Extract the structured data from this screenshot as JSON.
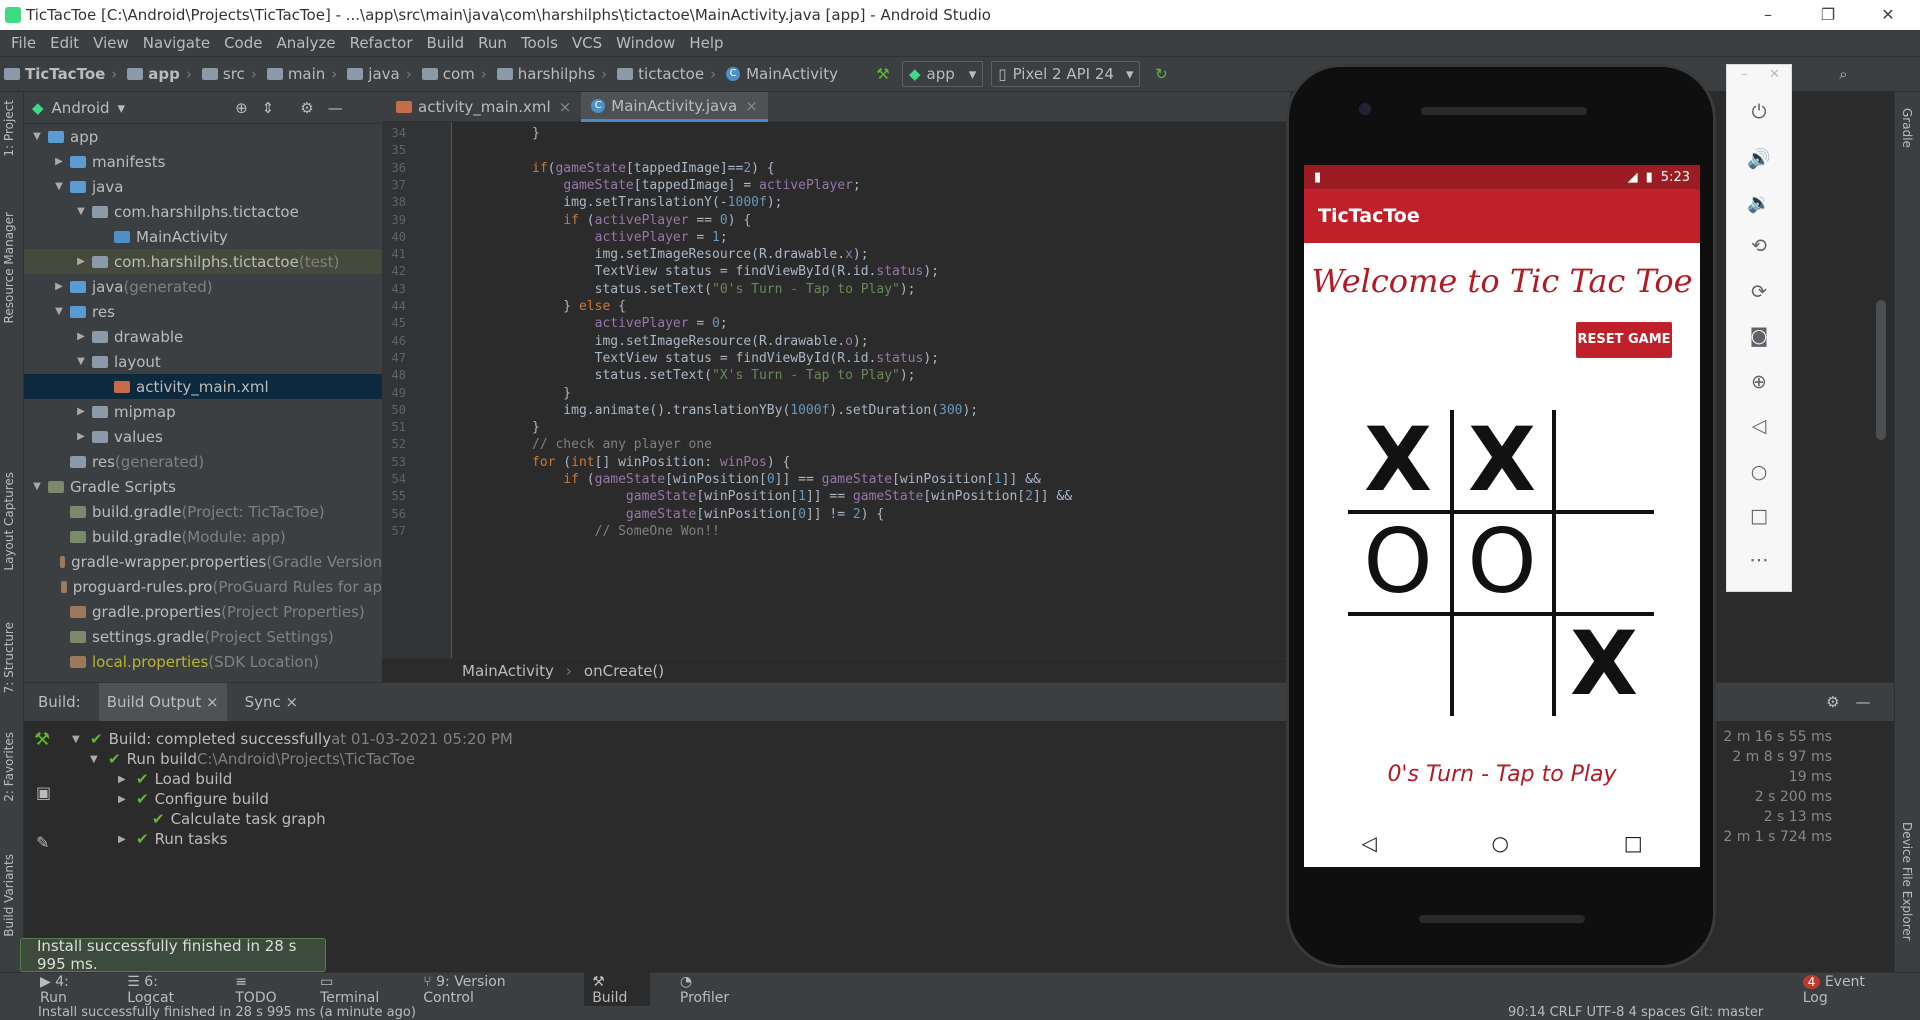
{
  "window": {
    "title": "TicTacToe [C:\\Android\\Projects\\TicTacToe] - ...\\app\\src\\main\\java\\com\\harshilphs\\tictactoe\\MainActivity.java [app] - Android Studio"
  },
  "menu": [
    "File",
    "Edit",
    "View",
    "Navigate",
    "Code",
    "Analyze",
    "Refactor",
    "Build",
    "Run",
    "Tools",
    "VCS",
    "Window",
    "Help"
  ],
  "breadcrumbs": [
    "TicTacToe",
    "app",
    "src",
    "main",
    "java",
    "com",
    "harshilphs",
    "tictactoe",
    "MainActivity"
  ],
  "toolbar": {
    "config": "app",
    "device": "Pixel 2 API 24"
  },
  "project": {
    "view": "Android",
    "tree": [
      {
        "label": "app",
        "extra": "",
        "depth": 0,
        "arrow": "▼",
        "color": "#5b9bd5"
      },
      {
        "label": "manifests",
        "extra": "",
        "depth": 1,
        "arrow": "▶",
        "color": "#5b9bd5"
      },
      {
        "label": "java",
        "extra": "",
        "depth": 1,
        "arrow": "▼",
        "color": "#5b9bd5"
      },
      {
        "label": "com.harshilphs.tictactoe",
        "extra": "",
        "depth": 2,
        "arrow": "▼",
        "color": "#8a9aa8"
      },
      {
        "label": "MainActivity",
        "extra": "",
        "depth": 3,
        "arrow": "",
        "color": "#4e8fc7"
      },
      {
        "label": "com.harshilphs.tictactoe",
        "extra": " (test)",
        "depth": 2,
        "arrow": "▶",
        "color": "#8a9aa8"
      },
      {
        "label": "java",
        "extra": " (generated)",
        "depth": 1,
        "arrow": "▶",
        "color": "#5b9bd5"
      },
      {
        "label": "res",
        "extra": "",
        "depth": 1,
        "arrow": "▼",
        "color": "#5b9bd5"
      },
      {
        "label": "drawable",
        "extra": "",
        "depth": 2,
        "arrow": "▶",
        "color": "#8a9aa8"
      },
      {
        "label": "layout",
        "extra": "",
        "depth": 2,
        "arrow": "▼",
        "color": "#8a9aa8"
      },
      {
        "label": "activity_main.xml",
        "extra": "",
        "depth": 3,
        "arrow": "",
        "color": "#c66b4b"
      },
      {
        "label": "mipmap",
        "extra": "",
        "depth": 2,
        "arrow": "▶",
        "color": "#8a9aa8"
      },
      {
        "label": "values",
        "extra": "",
        "depth": 2,
        "arrow": "▶",
        "color": "#8a9aa8"
      },
      {
        "label": "res",
        "extra": " (generated)",
        "depth": 1,
        "arrow": "",
        "color": "#8a9aa8"
      },
      {
        "label": "Gradle Scripts",
        "extra": "",
        "depth": 0,
        "arrow": "▼",
        "color": "#7a8a6a"
      },
      {
        "label": "build.gradle",
        "extra": " (Project: TicTacToe)",
        "depth": 1,
        "arrow": "",
        "color": "#7a8a6a"
      },
      {
        "label": "build.gradle",
        "extra": " (Module: app)",
        "depth": 1,
        "arrow": "",
        "color": "#7a8a6a"
      },
      {
        "label": "gradle-wrapper.properties",
        "extra": " (Gradle Version",
        "depth": 1,
        "arrow": "",
        "color": "#9a7a5a"
      },
      {
        "label": "proguard-rules.pro",
        "extra": " (ProGuard Rules for ap",
        "depth": 1,
        "arrow": "",
        "color": "#9a7a5a"
      },
      {
        "label": "gradle.properties",
        "extra": " (Project Properties)",
        "depth": 1,
        "arrow": "",
        "color": "#9a7a5a"
      },
      {
        "label": "settings.gradle",
        "extra": " (Project Settings)",
        "depth": 1,
        "arrow": "",
        "color": "#7a8a6a"
      },
      {
        "label": "local.properties",
        "extra": " (SDK Location)",
        "depth": 1,
        "arrow": "",
        "color": "#9a7a5a"
      }
    ]
  },
  "editor": {
    "tabs": [
      "activity_main.xml",
      "MainActivity.java"
    ],
    "line_numbers": [
      "34",
      "35",
      "36",
      "37",
      "38",
      "39",
      "40",
      "41",
      "42",
      "43",
      "44",
      "45",
      "46",
      "47",
      "48",
      "49",
      "50",
      "51",
      "52",
      "53",
      "54",
      "55",
      "56",
      "57"
    ],
    "crumb": [
      "MainActivity",
      "onCreate()"
    ]
  },
  "build": {
    "tabs": [
      "Build:",
      "Build Output",
      "Sync"
    ],
    "rows": [
      {
        "text": "Build: completed successfully",
        "extra": " at 01-03-2021 05:20 PM",
        "time": "2 m 16 s 55 ms"
      },
      {
        "text": "Run build",
        "extra": " C:\\Android\\Projects\\TicTacToe",
        "time": "2 m 8 s 97 ms"
      },
      {
        "text": "Load build",
        "extra": "",
        "time": "19 ms"
      },
      {
        "text": "Configure build",
        "extra": "",
        "time": "2 s 200 ms"
      },
      {
        "text": "Calculate task graph",
        "extra": "",
        "time": "2 s 13 ms"
      },
      {
        "text": "Run tasks",
        "extra": "",
        "time": "2 m 1 s 724 ms"
      }
    ]
  },
  "toast": "Install successfully finished in 28 s 995 ms.",
  "bottom_tabs": [
    "4: Run",
    "6: Logcat",
    "TODO",
    "Terminal",
    "9: Version Control",
    "Build",
    "Profiler"
  ],
  "event_log": "Event Log",
  "event_count": "4",
  "status": "Install successfully finished in 28 s 995 ms (a minute ago)",
  "status_right": "90:14  CRLF  UTF-8  4 spaces  Git: master",
  "left_tabs": [
    "1: Project",
    "Resource Manager",
    "Layout Captures",
    "7: Structure",
    "2: Favorites",
    "Build Variants"
  ],
  "right_tabs": [
    "Gradle",
    "Device File Explorer"
  ],
  "phone": {
    "time": "5:23",
    "app_title": "TicTacToe",
    "welcome": "Welcome to Tic Tac Toe",
    "reset": "RESET GAME",
    "board": [
      "X",
      "X",
      "",
      "O",
      "O",
      "",
      "",
      "",
      "X"
    ],
    "turn": "0's Turn - Tap to Play"
  }
}
